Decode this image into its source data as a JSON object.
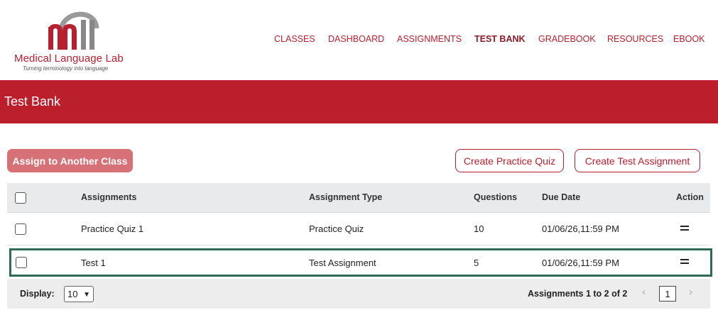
{
  "header": {
    "logo": {
      "name": "Medical Language Lab",
      "tagline": "Turning terminology into language",
      "mark": "mll"
    },
    "nav": [
      {
        "label": "CLASSES",
        "active": false
      },
      {
        "label": "DASHBOARD",
        "active": false
      },
      {
        "label": "ASSIGNMENTS",
        "active": false
      },
      {
        "label": "TEST BANK",
        "active": true
      },
      {
        "label": "GRADEBOOK",
        "active": false
      },
      {
        "label": "RESOURCES",
        "active": false
      },
      {
        "label": "EBOOK",
        "active": false
      }
    ]
  },
  "page": {
    "title": "Test Bank"
  },
  "actions": {
    "assign_label": "Assign to Another Class",
    "create_practice_label": "Create Practice Quiz",
    "create_test_label": "Create Test Assignment"
  },
  "table": {
    "columns": {
      "assignments": "Assignments",
      "type": "Assignment Type",
      "questions": "Questions",
      "due": "Due Date",
      "action": "Action"
    },
    "rows": [
      {
        "name": "Practice Quiz 1",
        "type": "Practice Quiz",
        "questions": "10",
        "due": "01/06/26,11:59 PM",
        "selected": false
      },
      {
        "name": "Test 1",
        "type": "Test Assignment",
        "questions": "5",
        "due": "01/06/26,11:59 PM",
        "selected": true
      }
    ]
  },
  "footer": {
    "display_label": "Display:",
    "display_value": "10",
    "pager_text": "Assignments 1 to 2 of 2",
    "current_page": "1",
    "prev_icon": "chevron-left-icon",
    "next_icon": "chevron-right-icon"
  },
  "colors": {
    "brand": "#bc1f2c",
    "assign_button": "#d77178",
    "selected_border": "#2e6b54"
  }
}
